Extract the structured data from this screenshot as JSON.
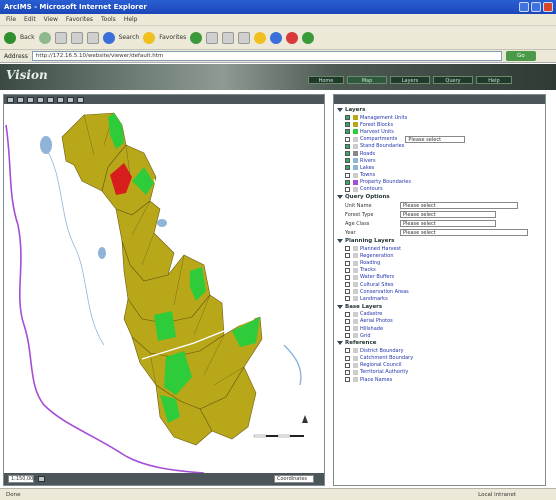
{
  "window": {
    "title": "ArcIMS - Microsoft Internet Explorer"
  },
  "menu": [
    "File",
    "Edit",
    "View",
    "Favorites",
    "Tools",
    "Help"
  ],
  "toolbar": {
    "back_label": "Back",
    "search_label": "Search",
    "favorites_label": "Favorites"
  },
  "address": {
    "label": "Address",
    "url": "http://172.16.5.10/website/viewer/default.htm",
    "go_label": "Go"
  },
  "banner": {
    "logo_text": "Vision",
    "nav_tabs": [
      "Home",
      "Map",
      "Layers",
      "Query",
      "Help"
    ]
  },
  "map_status": {
    "scale_value": "1:150,000",
    "coord_value": "Coordinates"
  },
  "layers": {
    "section_1": "Layers",
    "group_1": [
      "Management Units",
      "Forest Blocks",
      "Harvest Units",
      "Compartments",
      "Stand Boundaries",
      "Roads",
      "Rivers",
      "Lakes",
      "Towns",
      "Property Boundaries",
      "Contours"
    ],
    "select_placeholder": "Please select",
    "section_2": "Query Options",
    "filters": [
      {
        "label": "Unit Name",
        "value": "Please select"
      },
      {
        "label": "Forest Type",
        "value": "Please select"
      },
      {
        "label": "Age Class",
        "value": "Please select"
      },
      {
        "label": "Year",
        "value": "Please select"
      }
    ],
    "section_3": "Planning Layers",
    "group_3": [
      "Planned Harvest",
      "Regeneration",
      "Roading",
      "Tracks",
      "Water Buffers",
      "Cultural Sites",
      "Conservation Areas",
      "Landmarks"
    ],
    "section_4": "Base Layers",
    "group_4": [
      "Cadastre",
      "Aerial Photos",
      "Hillshade",
      "Grid"
    ],
    "section_5": "Reference",
    "group_5": [
      "District Boundary",
      "Catchment Boundary",
      "Regional Council",
      "Territorial Authority",
      "Place Names"
    ]
  },
  "statusbar": {
    "left_text": "Done",
    "right_text": "Local intranet"
  },
  "colors": {
    "stand": "#b9a71a",
    "harvest": "#2ecb3a",
    "selected": "#d81d1d",
    "river": "#a64dd6",
    "water": "#8fb4d8"
  }
}
